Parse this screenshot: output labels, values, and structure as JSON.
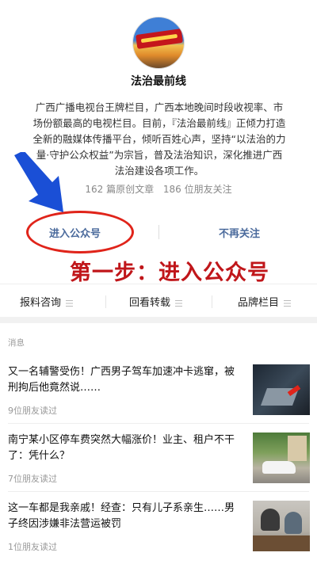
{
  "profile": {
    "account_name": "法治最前线",
    "description": "广西广播电视台王牌栏目，广西本地晚间时段收视率、市场份额最高的电视栏目。目前，『法治最前线』正倾力打造全新的融媒体传播平台，倾听百姓心声，坚持“以法治的力量·守护公众权益”为宗旨，普及法治知识，深化推进广西法治建设各项工作。",
    "original_articles": "162 篇原创文章",
    "friends_following": "186 位朋友关注"
  },
  "actions": {
    "enter_label": "进入公众号",
    "unfollow_label": "不再关注"
  },
  "annotation": {
    "caption": "第一步：进入公众号",
    "highlight_color": "#e0241a",
    "arrow_color": "#1a4fd6"
  },
  "menu": {
    "items": [
      {
        "label": "报料咨询",
        "icon": "menu-lines-icon"
      },
      {
        "label": "回看转载",
        "icon": "menu-lines-icon"
      },
      {
        "label": "品牌栏目",
        "icon": "menu-lines-icon"
      }
    ]
  },
  "messages": {
    "section_label": "消息",
    "articles": [
      {
        "title": "又一名辅警受伤！广西男子驾车加速冲卡逃窜，被刑拘后他竟然说……",
        "reads": "9位朋友读过"
      },
      {
        "title": "南宁某小区停车费突然大幅涨价！业主、租户不干了：凭什么？",
        "reads": "7位朋友读过"
      },
      {
        "title": "这一车都是我亲戚！经查：只有儿子系亲生……男子终因涉嫌非法营运被罚",
        "reads": "1位朋友读过"
      }
    ]
  },
  "colors": {
    "link_blue": "#4a6a9c",
    "caption_red": "#c0161a"
  }
}
